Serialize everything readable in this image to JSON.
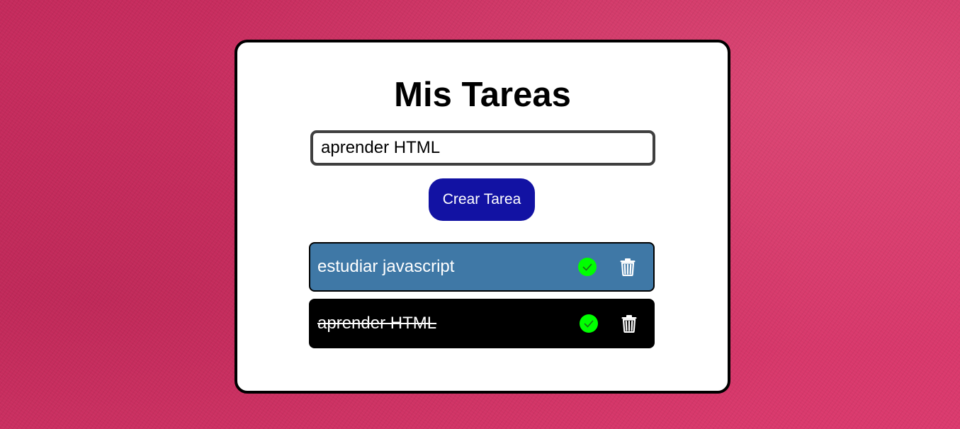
{
  "app": {
    "title": "Mis Tareas"
  },
  "form": {
    "input_value": "aprender HTML",
    "create_button_label": "Crear Tarea"
  },
  "tasks": [
    {
      "text": "estudiar javascript",
      "completed": false,
      "background": "#3f78a6"
    },
    {
      "text": "aprender HTML",
      "completed": true,
      "background": "#000000"
    }
  ],
  "icons": {
    "check": "check-circle-icon",
    "delete": "trash-icon"
  },
  "colors": {
    "button": "#1212a3",
    "check": "#00ff00",
    "background": "#cf2e62"
  }
}
